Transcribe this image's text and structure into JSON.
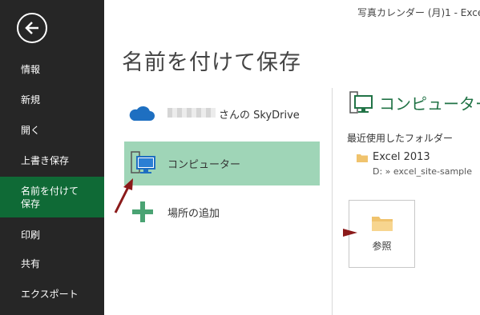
{
  "window": {
    "title": "写真カレンダー (月)1 - Excel"
  },
  "sidebar": {
    "back_icon": "back-arrow-icon",
    "items": [
      {
        "label": "情報"
      },
      {
        "label": "新規"
      },
      {
        "label": "開く"
      },
      {
        "label": "上書き保存"
      },
      {
        "label_line1": "名前を付けて",
        "label_line2": "保存",
        "active": true
      },
      {
        "label": "印刷"
      },
      {
        "label": "共有"
      },
      {
        "label": "エクスポート"
      }
    ],
    "colors": {
      "background": "#262626",
      "active": "#0f6a36"
    }
  },
  "main": {
    "title": "名前を付けて保存",
    "places": [
      {
        "label": "さんの SkyDrive",
        "icon": "cloud-icon"
      },
      {
        "label": "コンピューター",
        "icon": "computer-icon",
        "selected": true
      },
      {
        "label": "場所の追加",
        "icon": "plus-icon"
      }
    ]
  },
  "right_pane": {
    "title": "コンピューター",
    "title_icon": "computer-icon",
    "recent_folders_label": "最近使用したフォルダー",
    "recent": [
      {
        "name": "Excel 2013",
        "path": "D: » excel_site-sample",
        "icon": "folder-icon"
      }
    ],
    "browse_label": "参照",
    "accent": "#217346"
  }
}
